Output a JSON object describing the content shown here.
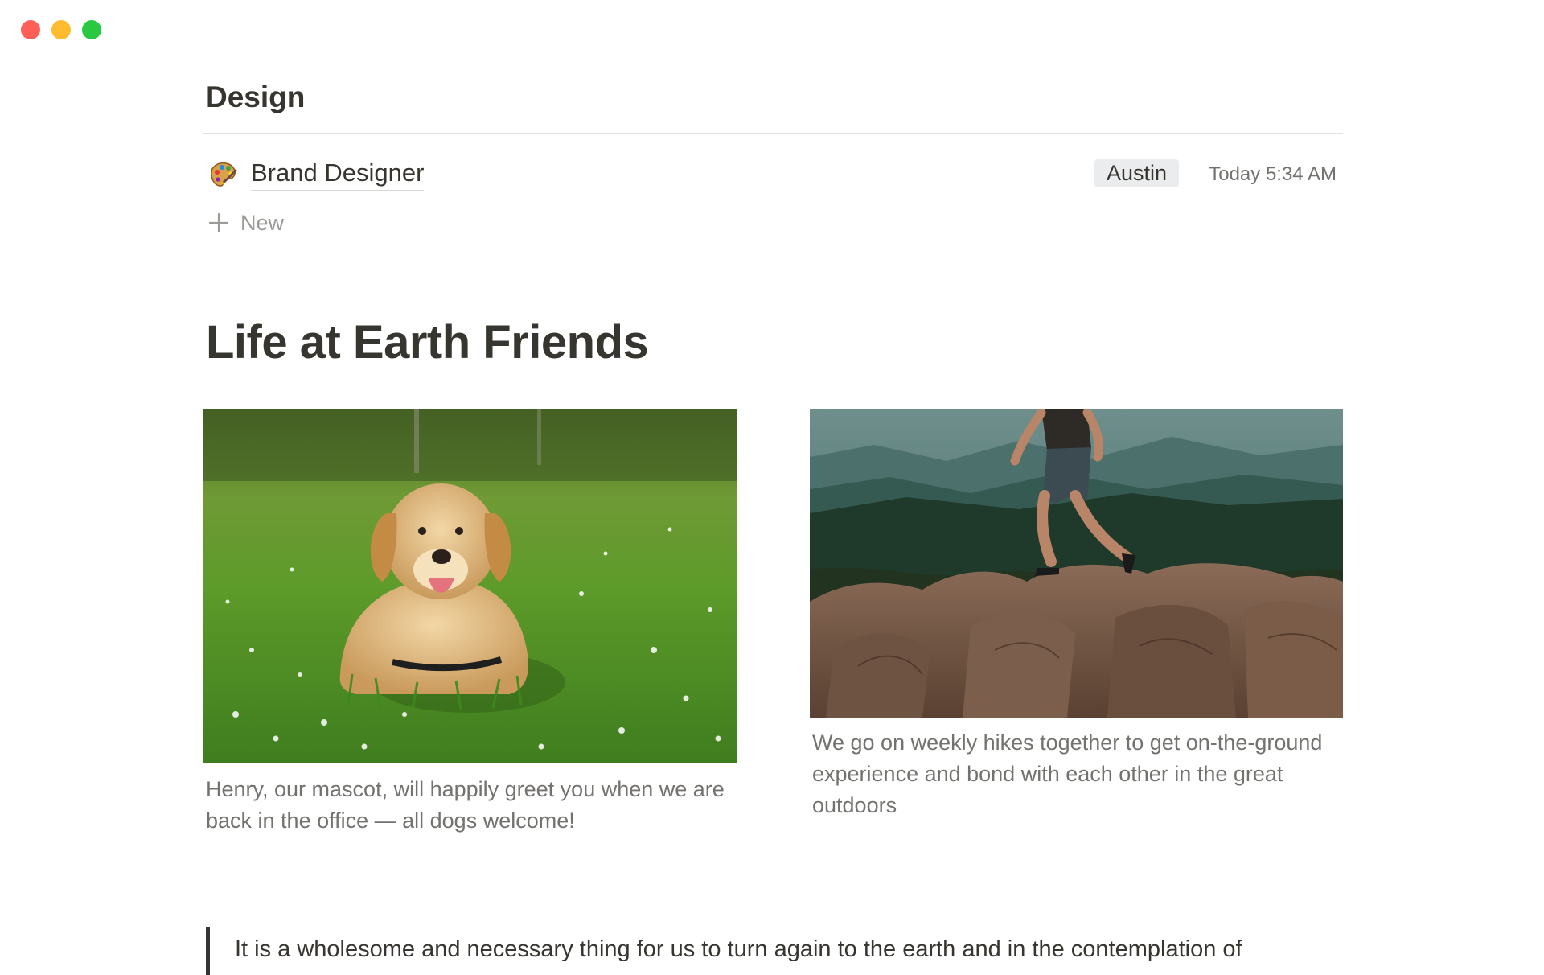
{
  "window": {
    "controls": [
      "close",
      "minimize",
      "zoom"
    ]
  },
  "group": {
    "title": "Design"
  },
  "row": {
    "icon": "palette-icon",
    "title": "Brand Designer",
    "tag": "Austin",
    "timestamp": "Today 5:34 AM"
  },
  "new_button": {
    "icon": "plus-icon",
    "label": "New"
  },
  "section": {
    "heading": "Life at Earth Friends"
  },
  "gallery": [
    {
      "image": "dog-in-meadow-photo",
      "caption": "Henry, our mascot, will happily greet you when we are back in the office — all dogs welcome!"
    },
    {
      "image": "hiker-on-rocks-photo",
      "caption": "We go on weekly hikes together to get on-the-ground experience and bond with each other in the great outdoors"
    }
  ],
  "quote": {
    "text": "It is a wholesome and necessary thing for us to turn again to the earth and in the contemplation of"
  },
  "colors": {
    "text": "#37352f",
    "muted": "#73726e",
    "placeholder": "#9b9a97",
    "tag_bg": "#ebeced",
    "divider": "#e3e2e0"
  }
}
